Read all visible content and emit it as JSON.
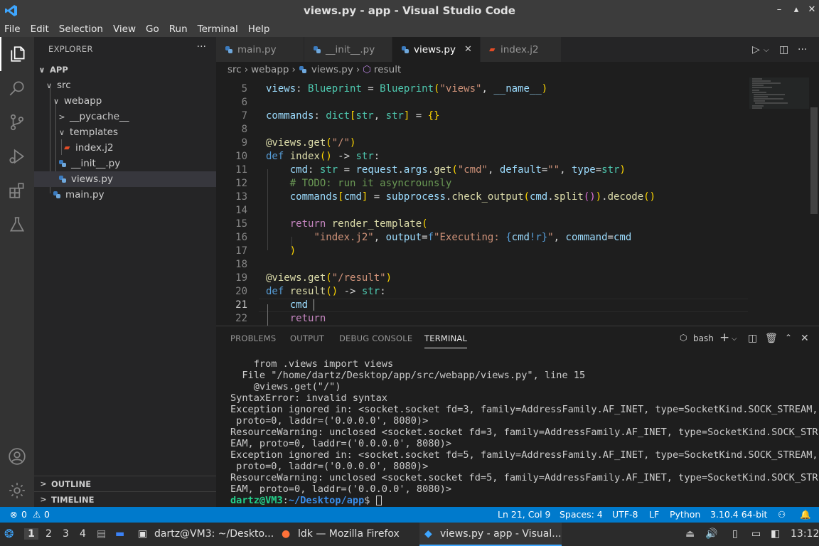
{
  "window": {
    "title": "views.py - app - Visual Studio Code",
    "controls": [
      "–",
      "▴",
      "✕"
    ]
  },
  "menu": [
    "File",
    "Edit",
    "Selection",
    "View",
    "Go",
    "Run",
    "Terminal",
    "Help"
  ],
  "sidebar": {
    "header": "EXPLORER",
    "more": "···",
    "tree": [
      {
        "label": "APP",
        "kind": "folder-root",
        "chevron": "∨"
      },
      {
        "label": "src",
        "kind": "folder",
        "chevron": "∨"
      },
      {
        "label": "webapp",
        "kind": "folder",
        "chevron": "∨"
      },
      {
        "label": "__pycache__",
        "kind": "folder",
        "chevron": ">"
      },
      {
        "label": "templates",
        "kind": "folder",
        "chevron": "∨"
      },
      {
        "label": "index.j2",
        "kind": "j2"
      },
      {
        "label": "__init__.py",
        "kind": "py"
      },
      {
        "label": "views.py",
        "kind": "py"
      },
      {
        "label": "main.py",
        "kind": "py"
      }
    ],
    "outline": "OUTLINE",
    "timeline": "TIMELINE"
  },
  "tabs": [
    {
      "label": "main.py",
      "icon": "python-icon"
    },
    {
      "label": "__init__.py",
      "icon": "python-icon"
    },
    {
      "label": "views.py",
      "icon": "python-icon",
      "active": true,
      "close": "✕"
    },
    {
      "label": "index.j2",
      "icon": "jinja-icon"
    }
  ],
  "breadcrumb": [
    "src",
    "webapp",
    "views.py",
    "result"
  ],
  "editor": {
    "line_numbers": [
      "5",
      "6",
      "7",
      "8",
      "9",
      "10",
      "11",
      "12",
      "13",
      "14",
      "15",
      "16",
      "17",
      "18",
      "19",
      "20",
      "21",
      "22"
    ],
    "current_line": "21"
  },
  "panel": {
    "tabs": [
      "PROBLEMS",
      "OUTPUT",
      "DEBUG CONSOLE",
      "TERMINAL"
    ],
    "active_tab": "TERMINAL",
    "shell": "bash",
    "terminal_lines": [
      "    from .views import views",
      "  File \"/home/dartz/Desktop/app/src/webapp/views.py\", line 15",
      "    @views.get(\"/\")",
      "SyntaxError: invalid syntax",
      "Exception ignored in: <socket.socket fd=3, family=AddressFamily.AF_INET, type=SocketKind.SOCK_STREAM,",
      " proto=0, laddr=('0.0.0.0', 8080)>",
      "ResourceWarning: unclosed <socket.socket fd=3, family=AddressFamily.AF_INET, type=SocketKind.SOCK_STR",
      "EAM, proto=0, laddr=('0.0.0.0', 8080)>",
      "Exception ignored in: <socket.socket fd=5, family=AddressFamily.AF_INET, type=SocketKind.SOCK_STREAM,",
      " proto=0, laddr=('0.0.0.0', 8080)>",
      "ResourceWarning: unclosed <socket.socket fd=5, family=AddressFamily.AF_INET, type=SocketKind.SOCK_STR",
      "EAM, proto=0, laddr=('0.0.0.0', 8080)>"
    ],
    "prompt_user": "dartz@VM3",
    "prompt_sep": ":",
    "prompt_path": "~/Desktop/app",
    "prompt_end": "$ "
  },
  "status": {
    "errors": "0",
    "warnings": "0",
    "position": "Ln 21, Col 9",
    "spaces": "Spaces: 4",
    "encoding": "UTF-8",
    "eol": "LF",
    "language": "Python",
    "interpreter": "3.10.4 64-bit"
  },
  "taskbar": {
    "workspaces": [
      "1",
      "2",
      "3",
      "4"
    ],
    "apps": [
      "dartz@VM3: ~/Deskto...",
      "ldk — Mozilla Firefox",
      "views.py - app - Visual..."
    ],
    "clock": "13:12"
  },
  "colors": {
    "accent": "#007acc",
    "titlebar": "#3c3c3c",
    "sidebar": "#252526",
    "editor": "#1e1e1e"
  }
}
